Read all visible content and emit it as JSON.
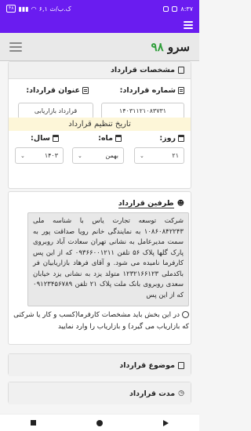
{
  "statusbar": {
    "time": "۸:۳۷",
    "speed": "۶,۱ ک.ب/ث",
    "battery": "۴۸"
  },
  "brand": {
    "name": "سرو",
    "number": "۹۸"
  },
  "contract_details": {
    "header": "مشخصات قرارداد",
    "number_label": "شماره قرارداد:",
    "number_value": "۱۴۰۳۱۱۲۱۰۸۳۷۳۱",
    "title_label": "عنوان قرارداد:",
    "title_value": "قرارداد بازاریابی",
    "date_banner": "تاریخ تنظیم قرارداد",
    "day_label": "روز:",
    "day_value": "۲۱",
    "month_label": "ماه:",
    "month_value": "بهمن",
    "year_label": "سال:",
    "year_value": "۱۴۰۳"
  },
  "parties": {
    "header": "طرفین قرارداد",
    "text": "شرکت توسعه تجارت یاس با شناسه ملی ۱۰۸۶۰۸۴۲۲۴۳ به نمایندگی خانم رویا صداقت پور به سمت مدیرعامل به نشانی تهران سعادت آباد روبروی پارک گلها پلاک ۵۶ تلفن ۰۹۳۶۶۰۰۱۲۱۱ که از این پس کارفرما نامیده می شود. و آقای فرهاد بازاریابیان فر باکدملی ۱۲۳۲۱۶۶۱۲۳ متولد یزد به نشانی یزد خیابان سعدی روبروی بانک ملت پلاک ۲۱ تلفن ۰۹۱۲۳۴۵۶۷۸۹ که از این پس",
    "note": "در این بخش باید مشخصات کارفرما(کسب و کار یا شرکتی که بازاریاب می گیرد) و بازاریاب را وارد نمایید"
  },
  "subject": {
    "header": "موضوع قرارداد"
  },
  "duration": {
    "header": "مدت قرارداد"
  }
}
